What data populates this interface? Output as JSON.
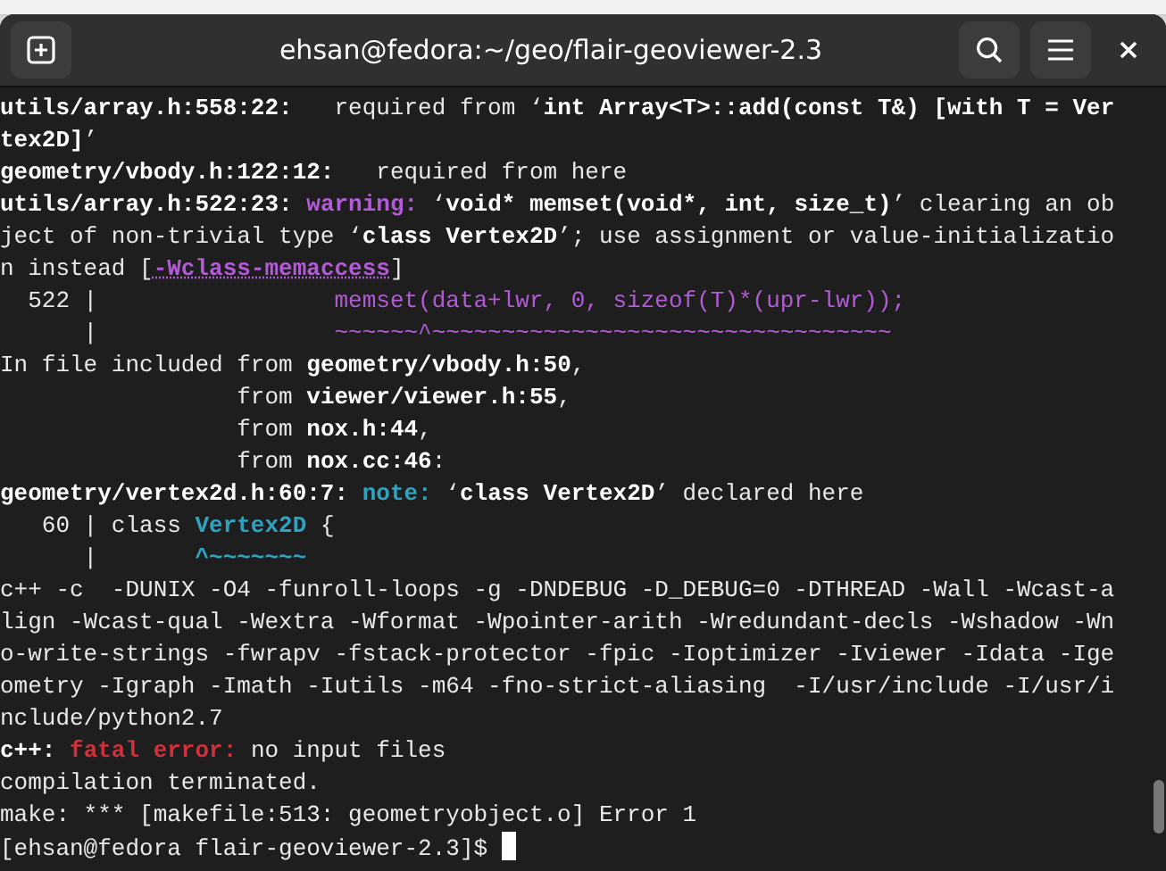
{
  "window": {
    "title": "ehsan@fedora:~/geo/flair-geoviewer-2.3"
  },
  "terminal": {
    "lines": [
      {
        "segments": [
          {
            "kind": "bold",
            "text": "utils/array.h:558:22:"
          },
          {
            "kind": "plain",
            "text": "   required from ‘"
          },
          {
            "kind": "bold",
            "text": "int Array<T>::add(const T&) [with T = Ver"
          }
        ]
      },
      {
        "segments": [
          {
            "kind": "bold",
            "text": "tex2D]"
          },
          {
            "kind": "plain",
            "text": "’"
          }
        ]
      },
      {
        "segments": [
          {
            "kind": "bold",
            "text": "geometry/vbody.h:122:12:"
          },
          {
            "kind": "plain",
            "text": "   required from here"
          }
        ]
      },
      {
        "segments": [
          {
            "kind": "bold",
            "text": "utils/array.h:522:23: "
          },
          {
            "kind": "warning",
            "text": "warning:"
          },
          {
            "kind": "plain",
            "text": " ‘"
          },
          {
            "kind": "bold",
            "text": "void* memset(void*, int, size_t)"
          },
          {
            "kind": "plain",
            "text": "’ clearing an ob"
          }
        ]
      },
      {
        "segments": [
          {
            "kind": "plain",
            "text": "ject of non-trivial type ‘"
          },
          {
            "kind": "bold",
            "text": "class Vertex2D"
          },
          {
            "kind": "plain",
            "text": "’; use assignment or value-initializatio"
          }
        ]
      },
      {
        "segments": [
          {
            "kind": "plain",
            "text": "n instead ["
          },
          {
            "kind": "link",
            "text": "-Wclass-memaccess"
          },
          {
            "kind": "plain",
            "text": "]"
          }
        ]
      },
      {
        "segments": [
          {
            "kind": "plain",
            "text": "  522 |                 "
          },
          {
            "kind": "purple",
            "text": "memset(data+lwr, 0, sizeof(T)*(upr-lwr));"
          }
        ]
      },
      {
        "segments": [
          {
            "kind": "plain",
            "text": "      |                 "
          },
          {
            "kind": "purple",
            "text": "~~~~~~^~~~~~~~~~~~~~~~~~~~~~~~~~~~~~~~~~"
          }
        ]
      },
      {
        "segments": [
          {
            "kind": "plain",
            "text": "In file included from "
          },
          {
            "kind": "bold",
            "text": "geometry/vbody.h:50"
          },
          {
            "kind": "plain",
            "text": ","
          }
        ]
      },
      {
        "segments": [
          {
            "kind": "plain",
            "text": "                 from "
          },
          {
            "kind": "bold",
            "text": "viewer/viewer.h:55"
          },
          {
            "kind": "plain",
            "text": ","
          }
        ]
      },
      {
        "segments": [
          {
            "kind": "plain",
            "text": "                 from "
          },
          {
            "kind": "bold",
            "text": "nox.h:44"
          },
          {
            "kind": "plain",
            "text": ","
          }
        ]
      },
      {
        "segments": [
          {
            "kind": "plain",
            "text": "                 from "
          },
          {
            "kind": "bold",
            "text": "nox.cc:46"
          },
          {
            "kind": "plain",
            "text": ":"
          }
        ]
      },
      {
        "segments": [
          {
            "kind": "bold",
            "text": "geometry/vertex2d.h:60:7: "
          },
          {
            "kind": "note",
            "text": "note:"
          },
          {
            "kind": "plain",
            "text": " ‘"
          },
          {
            "kind": "bold",
            "text": "class Vertex2D"
          },
          {
            "kind": "plain",
            "text": "’ declared here"
          }
        ]
      },
      {
        "segments": [
          {
            "kind": "plain",
            "text": "   60 | class "
          },
          {
            "kind": "teal",
            "text": "Vertex2D"
          },
          {
            "kind": "plain",
            "text": " {"
          }
        ]
      },
      {
        "segments": [
          {
            "kind": "plain",
            "text": "      |       "
          },
          {
            "kind": "teal",
            "text": "^~~~~~~~"
          }
        ]
      },
      {
        "segments": [
          {
            "kind": "plain",
            "text": "c++ -c  -DUNIX -O4 -funroll-loops -g -DNDEBUG -D_DEBUG=0 -DTHREAD -Wall -Wcast-a"
          }
        ]
      },
      {
        "segments": [
          {
            "kind": "plain",
            "text": "lign -Wcast-qual -Wextra -Wformat -Wpointer-arith -Wredundant-decls -Wshadow -Wn"
          }
        ]
      },
      {
        "segments": [
          {
            "kind": "plain",
            "text": "o-write-strings -fwrapv -fstack-protector -fpic -Ioptimizer -Iviewer -Idata -Ige"
          }
        ]
      },
      {
        "segments": [
          {
            "kind": "plain",
            "text": "ometry -Igraph -Imath -Iutils -m64 -fno-strict-aliasing  -I/usr/include -I/usr/i"
          }
        ]
      },
      {
        "segments": [
          {
            "kind": "plain",
            "text": "nclude/python2.7"
          }
        ]
      },
      {
        "segments": [
          {
            "kind": "bold",
            "text": "c++: "
          },
          {
            "kind": "error",
            "text": "fatal error:"
          },
          {
            "kind": "plain",
            "text": " no input files"
          }
        ]
      },
      {
        "segments": [
          {
            "kind": "plain",
            "text": "compilation terminated."
          }
        ]
      },
      {
        "segments": [
          {
            "kind": "plain",
            "text": "make: *** [makefile:513: geometryobject.o] Error 1"
          }
        ]
      },
      {
        "segments": [
          {
            "kind": "plain",
            "text": "[ehsan@fedora flair-geoviewer-2.3]$ "
          }
        ],
        "cursor": true
      }
    ]
  }
}
